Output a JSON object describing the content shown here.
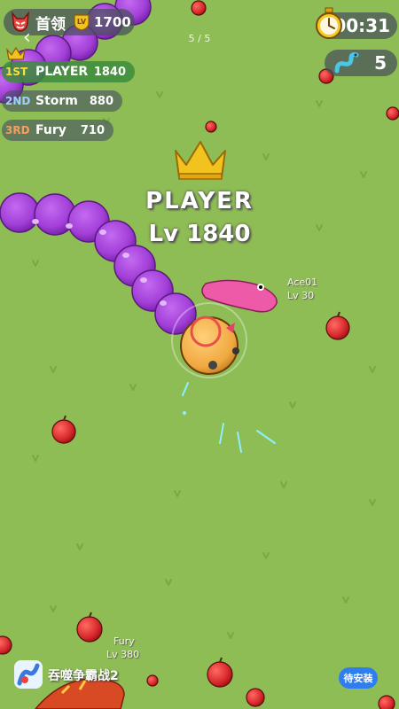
{
  "boss": {
    "label": "首领",
    "lv_badge": "LV",
    "level": "1700"
  },
  "nav": {
    "back": "‹",
    "page_indicator": "5 / 5"
  },
  "leaderboard": [
    {
      "rank": "1ST",
      "name": "PLAYER",
      "score": "1840"
    },
    {
      "rank": "2ND",
      "name": "Storm",
      "score": "880"
    },
    {
      "rank": "3RD",
      "name": "Fury",
      "score": "710"
    }
  ],
  "timer": {
    "value": "00:31",
    "icon": "stopwatch-icon"
  },
  "kills": {
    "value": "5",
    "icon": "worm-icon"
  },
  "player": {
    "name": "PLAYER",
    "level": "Lv 1840",
    "icon": "crown-icon"
  },
  "enemies": [
    {
      "name": "Ace01",
      "level": "Lv 30"
    },
    {
      "name": "Fury",
      "level": "Lv 380"
    }
  ],
  "ad": {
    "app_name": "吞噬争霸战2",
    "install_label": "待安装"
  },
  "colors": {
    "grass": "#8fbd55",
    "player_body": "#a23fd8",
    "player_head": "#f0a840",
    "enemy_ace": "#ec5aa8",
    "apple": "#d8282c",
    "crown": "#f2c21e",
    "install": "#2f7ef0"
  }
}
